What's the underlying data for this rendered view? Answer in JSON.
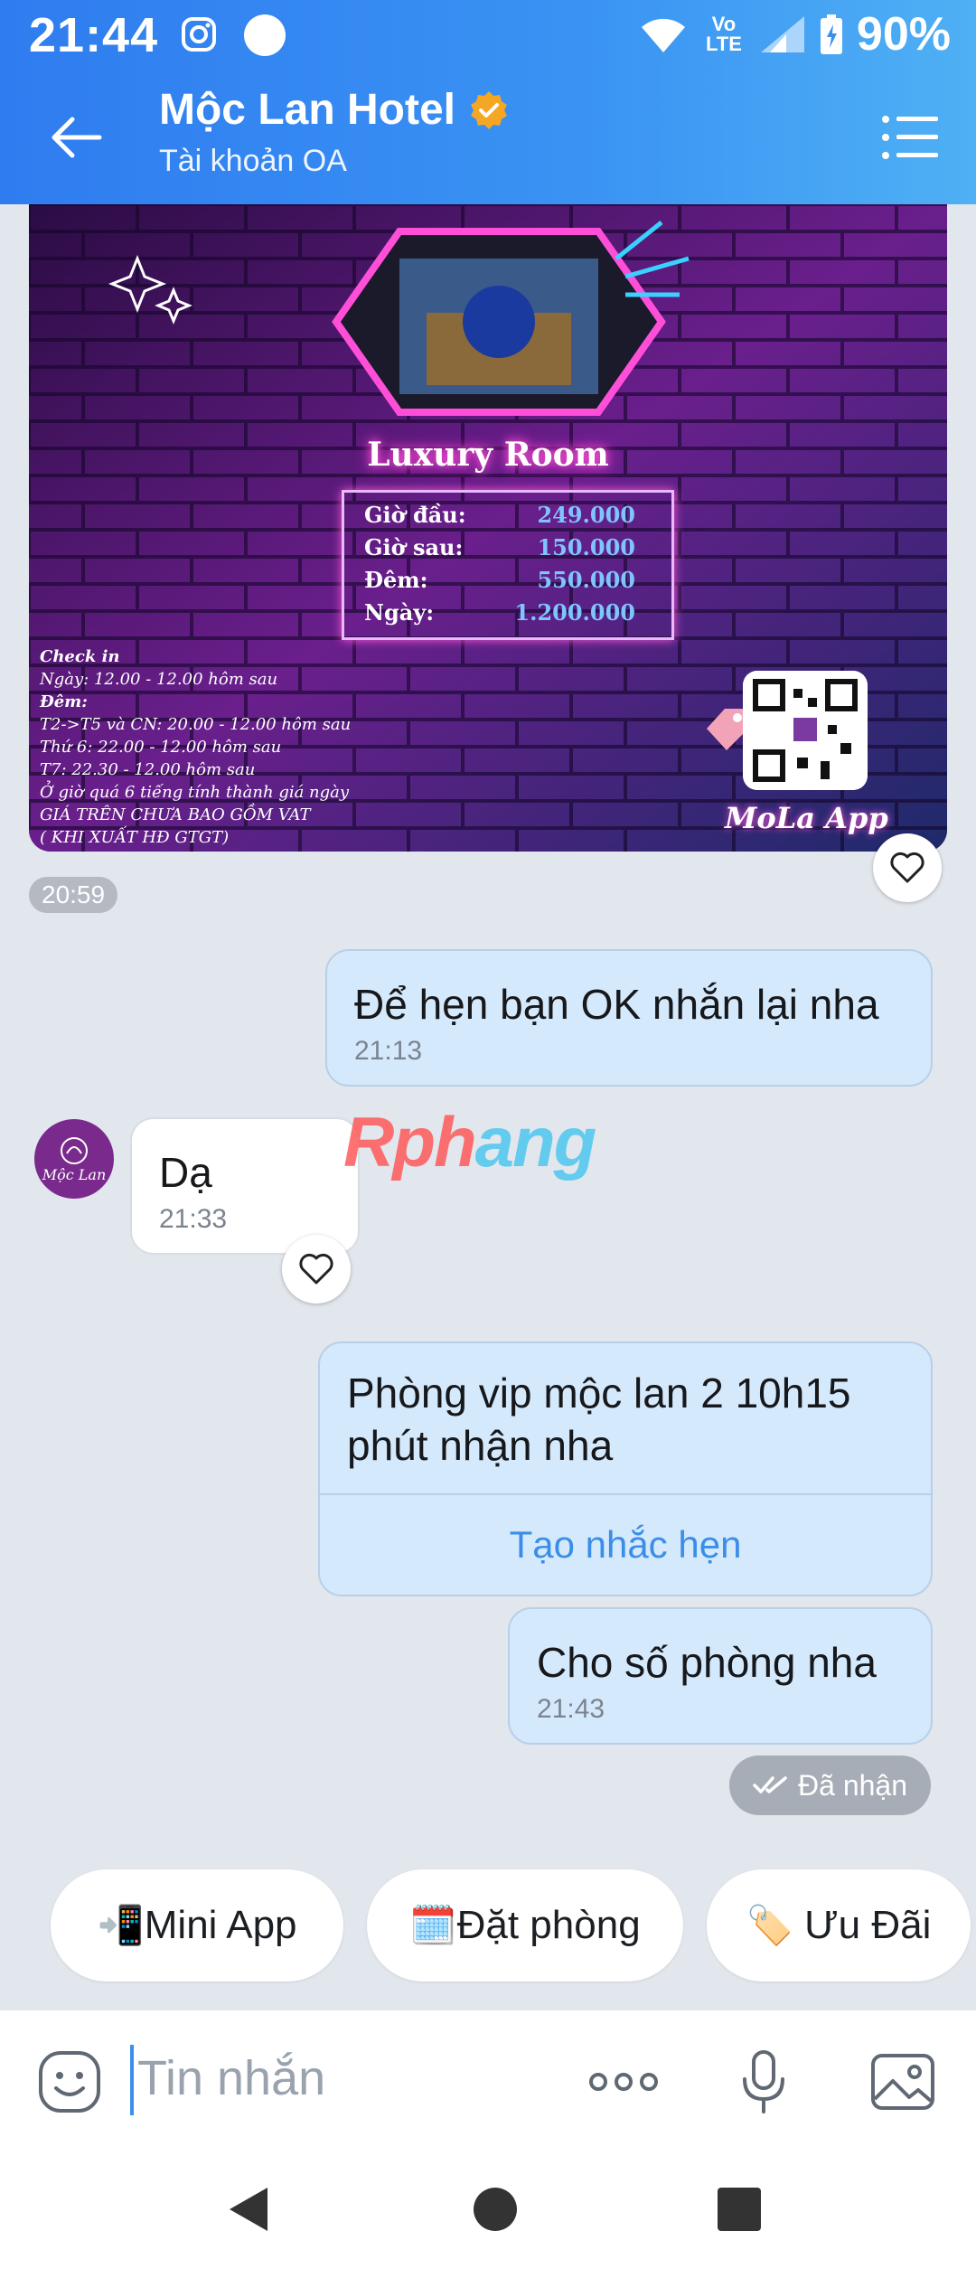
{
  "status_bar": {
    "time": "21:44",
    "network": "Vo LTE",
    "battery": "90%"
  },
  "header": {
    "title": "Mộc Lan Hotel",
    "subtitle": "Tài khoản OA",
    "icons": [
      "back-arrow-icon",
      "verified-badge-icon",
      "menu-list-icon"
    ]
  },
  "poster": {
    "title": "Luxury Room",
    "prices": [
      {
        "label": "Giờ đầu:",
        "value": "249.000"
      },
      {
        "label": "Giờ sau:",
        "value": "150.000"
      },
      {
        "label": "Đêm:",
        "value": "550.000"
      },
      {
        "label": "Ngày:",
        "value": "1.200.000"
      }
    ],
    "notes": [
      "Check in",
      "Ngày: 12.00 - 12.00 hôm sau",
      "Đêm:",
      "T2->T5 và CN: 20.00 - 12.00 hôm sau",
      "Thứ 6: 22.00 - 12.00 hôm sau",
      "T7: 22.30 - 12.00 hôm sau",
      "Ở giờ quá 6 tiếng tính thành giá ngày",
      "GIÁ TRÊN CHƯA BAO GỒM VAT",
      "( KHI XUẤT HĐ GTGT)"
    ],
    "brand": "MoLa App"
  },
  "messages": {
    "poster_time": "20:59",
    "m1": {
      "text": "Để hẹn bạn OK nhắn lại nha",
      "time": "21:13"
    },
    "m2": {
      "text": "Dạ",
      "time": "21:33",
      "avatar_text": "Mộc Lan"
    },
    "m3": {
      "text": "Phòng vip mộc lan 2 10h15 phút nhận nha",
      "action": "Tạo nhắc hẹn"
    },
    "m4": {
      "text": "Cho số phòng nha",
      "time": "21:43"
    },
    "received": "Đã nhận"
  },
  "watermark": {
    "part1": "Rph",
    "part2": "ang"
  },
  "quick_actions": [
    {
      "emoji": "📲",
      "label": "Mini App"
    },
    {
      "emoji": "🗓️",
      "label": "Đặt phòng"
    },
    {
      "emoji": "🏷️",
      "label": "Ưu Đãi"
    }
  ],
  "input": {
    "placeholder": "Tin nhắn"
  },
  "colors": {
    "header_blue": "#3a8ef0",
    "outgoing_bubble": "#d5e9fc",
    "link_blue": "#3b8ee8"
  }
}
